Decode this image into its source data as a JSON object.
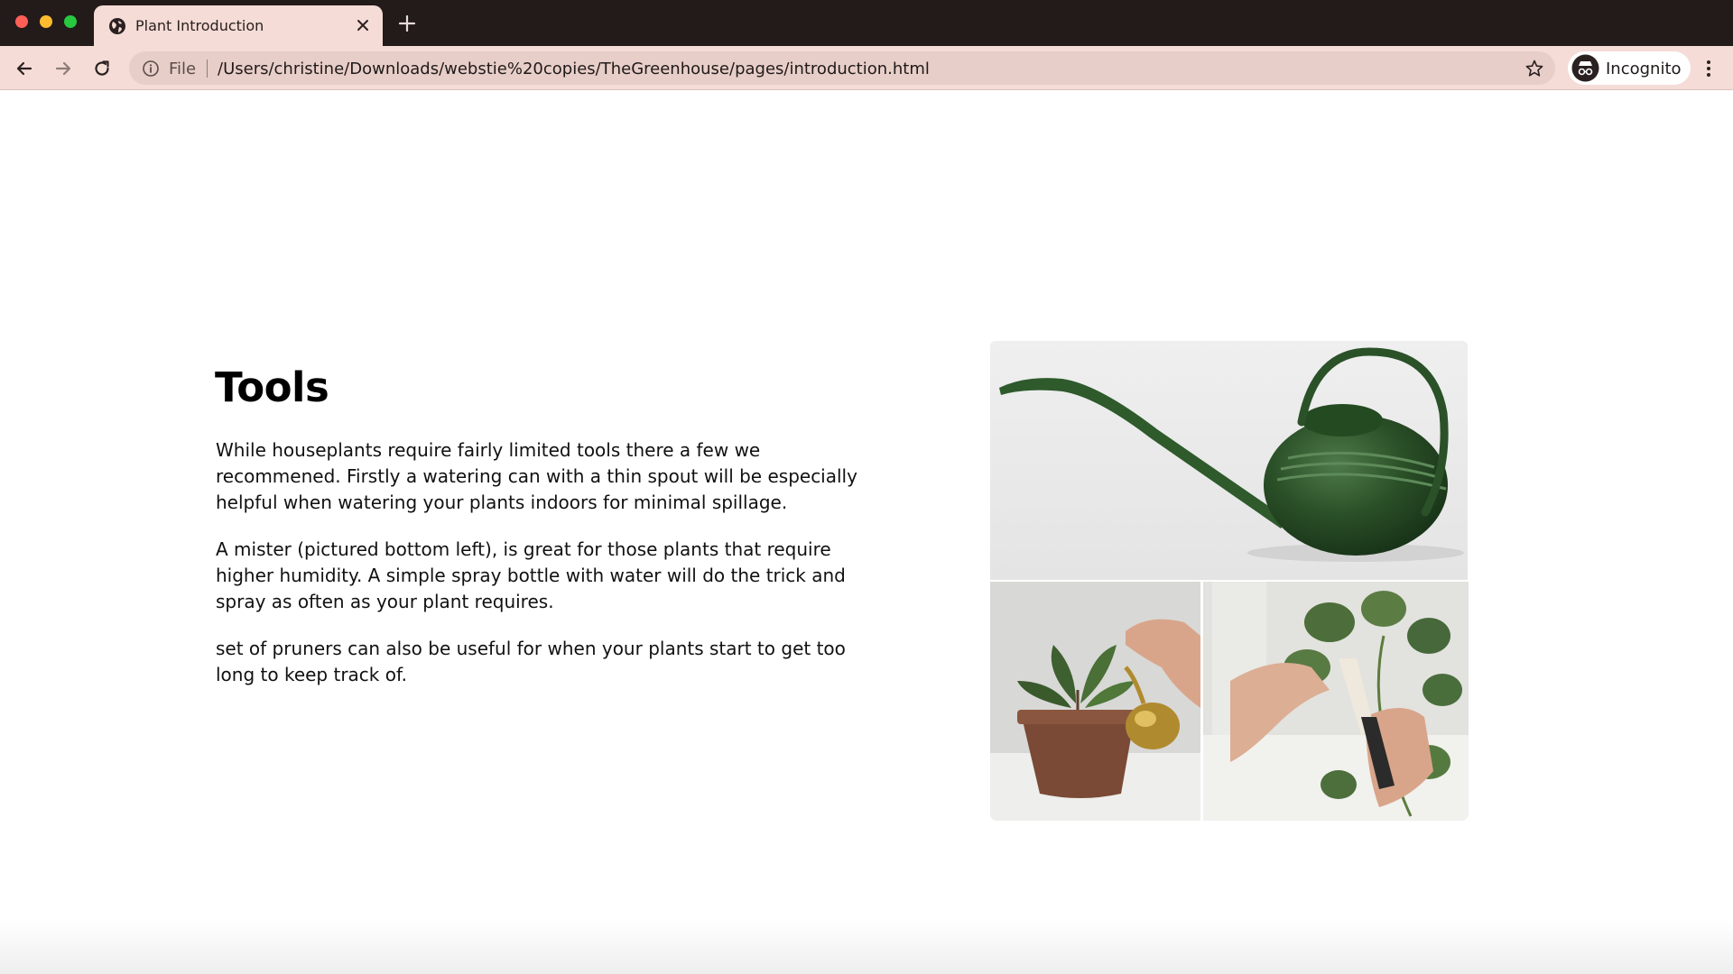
{
  "browser": {
    "tab_title": "Plant Introduction",
    "omnibox": {
      "scheme_label": "File",
      "url": "/Users/christine/Downloads/webstie%20copies/TheGreenhouse/pages/introduction.html"
    },
    "profile_label": "Incognito",
    "icons": {
      "tab_favicon": "globe-icon",
      "tab_close": "close-icon",
      "new_tab": "plus-icon",
      "back": "arrow-left-icon",
      "forward": "arrow-right-icon",
      "reload": "reload-icon",
      "site_info": "info-icon",
      "bookmark": "star-icon",
      "profile": "incognito-icon",
      "menu": "kebab-menu-icon"
    },
    "colors": {
      "titlebar": "#231a1a",
      "tab_and_toolbar": "#f5dcd6",
      "omnibox": "#e8cec8"
    }
  },
  "page": {
    "heading": "Tools",
    "paragraphs": [
      "While houseplants require fairly limited tools there a few we recommened. Firstly a watering can with a thin spout will be especially helpful when watering your plants indoors for minimal spillage.",
      "A mister (pictured bottom left), is great for those plants that require higher humidity. A simple spray bottle with water will do the trick and spray as often as your plant requires.",
      "set of pruners can also be useful for when your plants start to get too long to keep track of."
    ],
    "images": {
      "top": "watering-can-photo",
      "bottom_left": "mister-photo",
      "bottom_right": "pruners-photo"
    }
  }
}
